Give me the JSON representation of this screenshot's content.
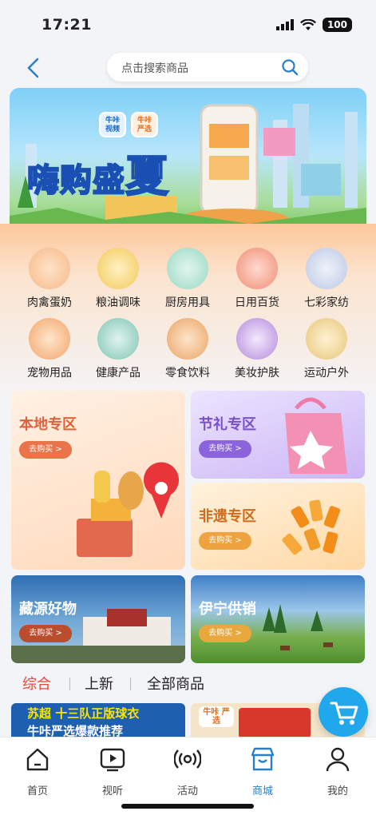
{
  "status": {
    "time": "17:21",
    "battery": "100"
  },
  "header": {
    "search_placeholder": "点击搜索商品"
  },
  "banner": {
    "title_a": "嗨购盛",
    "title_b": "夏",
    "badge1": "牛咔 视频",
    "badge2": "牛咔 严选"
  },
  "categories": [
    {
      "label": "肉禽蛋奶",
      "icon": "meat-eggs-milk-icon"
    },
    {
      "label": "粮油调味",
      "icon": "grain-oil-icon"
    },
    {
      "label": "厨房用具",
      "icon": "kitchenware-icon"
    },
    {
      "label": "日用百货",
      "icon": "daily-goods-icon"
    },
    {
      "label": "七彩家纺",
      "icon": "home-textile-icon"
    },
    {
      "label": "宠物用品",
      "icon": "pet-supplies-icon"
    },
    {
      "label": "健康产品",
      "icon": "health-products-icon"
    },
    {
      "label": "零食饮料",
      "icon": "snacks-drinks-icon"
    },
    {
      "label": "美妆护肤",
      "icon": "beauty-skincare-icon"
    },
    {
      "label": "运动户外",
      "icon": "sports-outdoor-icon"
    }
  ],
  "zones": {
    "local": {
      "title": "本地专区",
      "button": "去购买 >"
    },
    "festival": {
      "title": "节礼专区",
      "button": "去购买 >"
    },
    "heritage": {
      "title": "非遗专区",
      "button": "去购买 >"
    },
    "tibet": {
      "title": "藏源好物",
      "button": "去购买 >"
    },
    "yining": {
      "title": "伊宁供销",
      "button": "去购买 >"
    }
  },
  "product_tabs": [
    "综合",
    "上新",
    "全部商品"
  ],
  "product_preview": {
    "text": "苏超 十三队正版球衣",
    "sub": "牛咔严选爆款推荐",
    "badge": "牛咔 严选"
  },
  "tabbar": [
    {
      "label": "首页",
      "icon": "home-icon"
    },
    {
      "label": "视听",
      "icon": "video-play-icon"
    },
    {
      "label": "活动",
      "icon": "broadcast-icon"
    },
    {
      "label": "商城",
      "icon": "store-icon"
    },
    {
      "label": "我的",
      "icon": "profile-icon"
    }
  ],
  "colors": {
    "accent_blue": "#2a7fc9",
    "tab_red": "#e34a3a",
    "cart_blue": "#21a8ec"
  }
}
